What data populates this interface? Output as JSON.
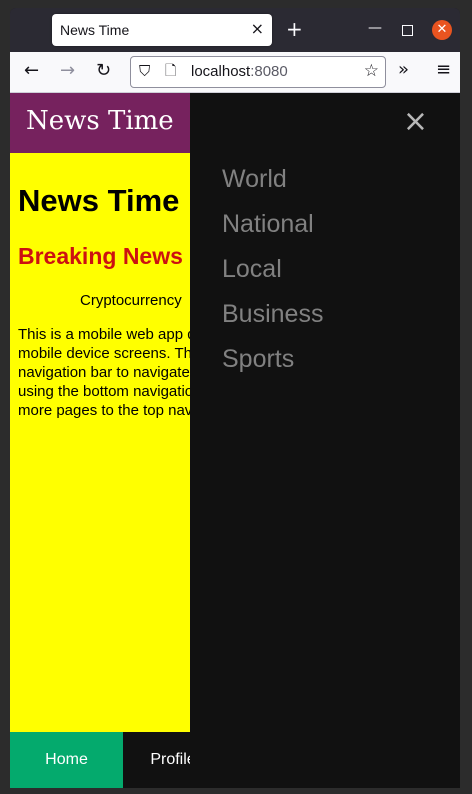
{
  "browser": {
    "tab_title": "News Time",
    "tab_close": "×",
    "new_tab": "+",
    "url_host": "localhost",
    "url_port": ":8080"
  },
  "site": {
    "brand": "News Time",
    "heading": "News Time",
    "breaking": "Breaking News",
    "topic": "Cryptocurrency",
    "body": "This is a mobile web app designed for mobile device screens. The bottom has a navigation bar to navigate to different pages using the bottom navigation bar. You can add more pages to the top nav bar."
  },
  "bottom_nav": {
    "items": [
      {
        "label": "Home"
      },
      {
        "label": "Profile"
      }
    ],
    "active_color": "#04aa6d"
  },
  "side_menu": {
    "close": "×",
    "items": [
      {
        "label": "World"
      },
      {
        "label": "National"
      },
      {
        "label": "Local"
      },
      {
        "label": "Business"
      },
      {
        "label": "Sports"
      }
    ]
  },
  "colors": {
    "page_bg": "#ffff00",
    "header_bg": "#76225e",
    "breaking": "#cc1111",
    "menu_bg": "#111111",
    "menu_text": "#818181"
  }
}
